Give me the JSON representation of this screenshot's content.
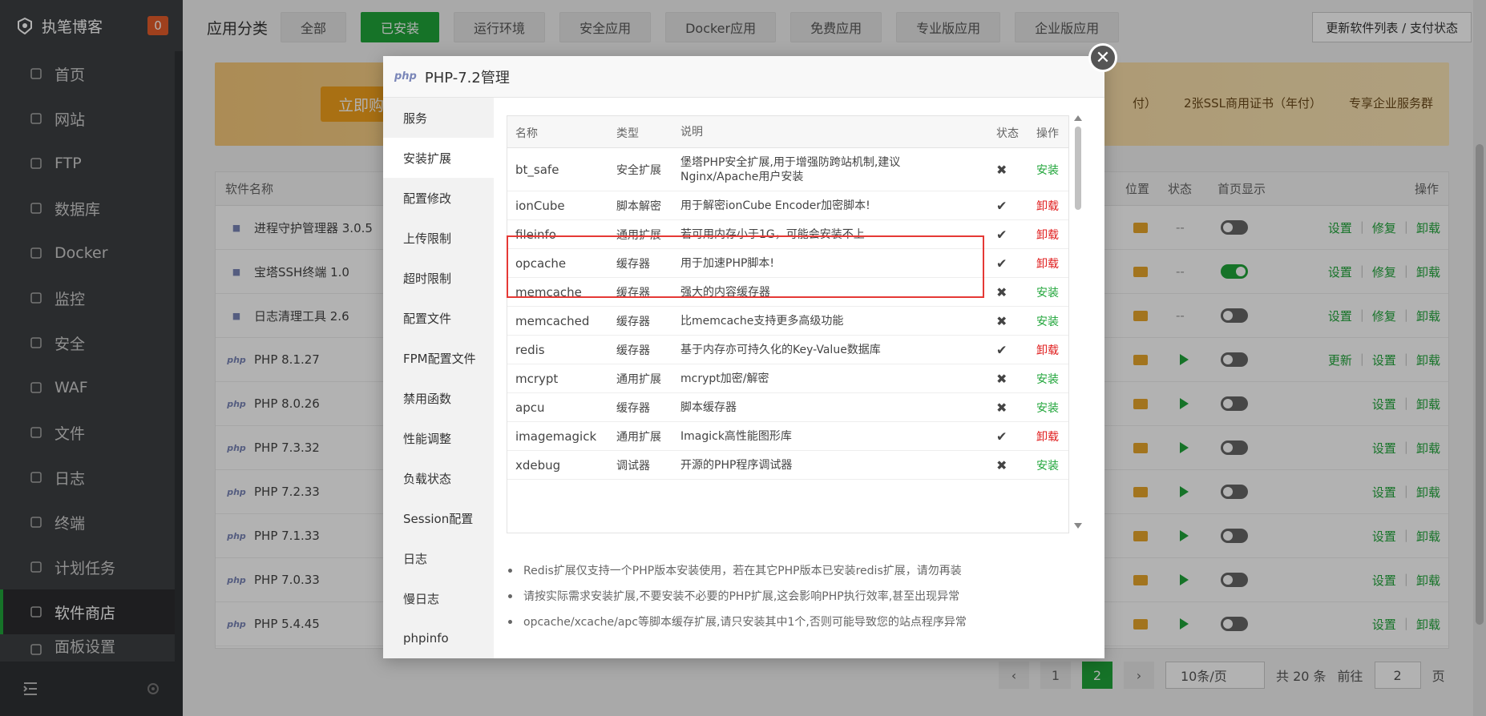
{
  "sidebar": {
    "brand": "执笔博客",
    "badge": "0",
    "items": [
      {
        "label": "首页",
        "icon": "home-icon"
      },
      {
        "label": "网站",
        "icon": "globe-icon"
      },
      {
        "label": "FTP",
        "icon": "ftp-icon"
      },
      {
        "label": "数据库",
        "icon": "database-icon"
      },
      {
        "label": "Docker",
        "icon": "docker-icon"
      },
      {
        "label": "监控",
        "icon": "monitor-icon"
      },
      {
        "label": "安全",
        "icon": "shield-icon"
      },
      {
        "label": "WAF",
        "icon": "waf-icon"
      },
      {
        "label": "文件",
        "icon": "folder-icon"
      },
      {
        "label": "日志",
        "icon": "log-icon"
      },
      {
        "label": "终端",
        "icon": "terminal-icon"
      },
      {
        "label": "计划任务",
        "icon": "calendar-icon"
      },
      {
        "label": "软件商店",
        "icon": "grid-icon"
      },
      {
        "label": "面板设置",
        "icon": "gear-icon"
      }
    ]
  },
  "topbar": {
    "label": "应用分类",
    "categories": [
      "全部",
      "已安装",
      "运行环境",
      "安全应用",
      "Docker应用",
      "免费应用",
      "专业版应用",
      "企业版应用"
    ],
    "update_button": "更新软件列表 / 支付状态"
  },
  "banner": {
    "buy_label": "立即购买",
    "items": [
      "2张SSL商用证书（年付）",
      "专享企业服务群"
    ],
    "partial_item": "付）"
  },
  "soft_table": {
    "headers": {
      "name": "软件名称",
      "location": "位置",
      "state": "状态",
      "home": "首页显示",
      "ops": "操作"
    },
    "rows": [
      {
        "name": "进程守护管理器 3.0.5",
        "state": "--",
        "home_on": false,
        "ops": [
          "设置",
          "修复",
          "卸载"
        ]
      },
      {
        "name": "宝塔SSH终端 1.0",
        "state": "--",
        "home_on": true,
        "ops": [
          "设置",
          "修复",
          "卸载"
        ]
      },
      {
        "name": "日志清理工具 2.6",
        "state": "--",
        "home_on": false,
        "ops": [
          "设置",
          "修复",
          "卸载"
        ]
      },
      {
        "name": "PHP 8.1.27",
        "state": "play",
        "home_on": false,
        "ops": [
          "更新",
          "设置",
          "卸载"
        ]
      },
      {
        "name": "PHP 8.0.26",
        "state": "play",
        "home_on": false,
        "ops": [
          "设置",
          "卸载"
        ]
      },
      {
        "name": "PHP 7.3.32",
        "state": "play",
        "home_on": false,
        "ops": [
          "设置",
          "卸载"
        ]
      },
      {
        "name": "PHP 7.2.33",
        "state": "play",
        "home_on": false,
        "ops": [
          "设置",
          "卸载"
        ]
      },
      {
        "name": "PHP 7.1.33",
        "state": "play",
        "home_on": false,
        "ops": [
          "设置",
          "卸载"
        ]
      },
      {
        "name": "PHP 7.0.33",
        "state": "play",
        "home_on": false,
        "ops": [
          "设置",
          "卸载"
        ]
      },
      {
        "name": "PHP 5.4.45",
        "state": "play",
        "home_on": false,
        "ops": [
          "设置",
          "卸载"
        ]
      }
    ]
  },
  "pager": {
    "prev": "‹",
    "page1": "1",
    "page2": "2",
    "next": "›",
    "per_page": "10条/页",
    "total": "共 20 条",
    "goto_label": "前往",
    "goto_value": "2",
    "page_suffix": "页"
  },
  "modal": {
    "icon_text": "php",
    "title": "PHP-7.2管理",
    "close": "✕",
    "menu": [
      "服务",
      "安装扩展",
      "配置修改",
      "上传限制",
      "超时限制",
      "配置文件",
      "FPM配置文件",
      "禁用函数",
      "性能调整",
      "负载状态",
      "Session配置",
      "日志",
      "慢日志",
      "phpinfo"
    ],
    "active_menu": 1,
    "table_headers": {
      "name": "名称",
      "type": "类型",
      "desc": "说明",
      "state": "状态",
      "op": "操作"
    },
    "extensions": [
      {
        "name": "bt_safe",
        "type": "安全扩展",
        "desc": "堡塔PHP安全扩展,用于增强防跨站机制,建议Nginx/Apache用户安装",
        "installed": false,
        "op": "安装"
      },
      {
        "name": "ionCube",
        "type": "脚本解密",
        "desc": "用于解密ionCube Encoder加密脚本!",
        "installed": true,
        "op": "卸载"
      },
      {
        "name": "fileinfo",
        "type": "通用扩展",
        "desc": "若可用内存小于1G，可能会安装不上",
        "installed": true,
        "op": "卸载"
      },
      {
        "name": "opcache",
        "type": "缓存器",
        "desc": "用于加速PHP脚本!",
        "installed": true,
        "op": "卸载"
      },
      {
        "name": "memcache",
        "type": "缓存器",
        "desc": "强大的内容缓存器",
        "installed": false,
        "op": "安装"
      },
      {
        "name": "memcached",
        "type": "缓存器",
        "desc": "比memcache支持更多高级功能",
        "installed": false,
        "op": "安装"
      },
      {
        "name": "redis",
        "type": "缓存器",
        "desc": "基于内存亦可持久化的Key-Value数据库",
        "installed": true,
        "op": "卸载"
      },
      {
        "name": "mcrypt",
        "type": "通用扩展",
        "desc": "mcrypt加密/解密",
        "installed": false,
        "op": "安装"
      },
      {
        "name": "apcu",
        "type": "缓存器",
        "desc": "脚本缓存器",
        "installed": false,
        "op": "安装"
      },
      {
        "name": "imagemagick",
        "type": "通用扩展",
        "desc": "Imagick高性能图形库",
        "installed": true,
        "op": "卸载"
      },
      {
        "name": "xdebug",
        "type": "调试器",
        "desc": "开源的PHP程序调试器",
        "installed": false,
        "op": "安装"
      }
    ],
    "notes": [
      "Redis扩展仅支持一个PHP版本安装使用，若在其它PHP版本已安装redis扩展，请勿再装",
      "请按实际需求安装扩展,不要安装不必要的PHP扩展,这会影响PHP执行效率,甚至出现异常",
      "opcache/xcache/apc等脚本缓存扩展,请只安装其中1个,否则可能导致您的站点程序异常"
    ]
  },
  "colors": {
    "accent": "#20a53a",
    "danger": "#e02020",
    "sidebar": "#3d3f42",
    "highlight": "#e53935"
  }
}
